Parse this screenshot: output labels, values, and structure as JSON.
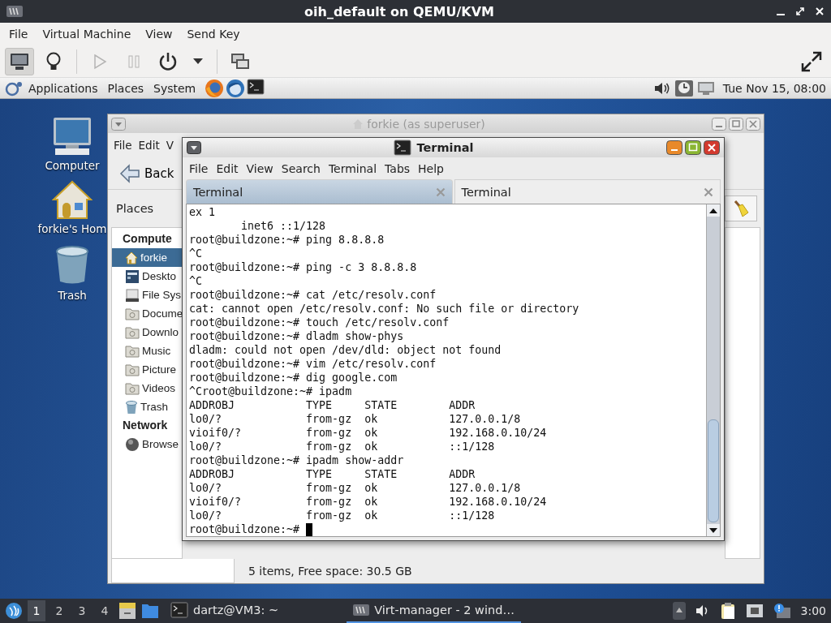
{
  "window": {
    "title": "oih_default on QEMU/KVM"
  },
  "menu": [
    "File",
    "Virtual Machine",
    "View",
    "Send Key"
  ],
  "toolbar": {
    "groups": [
      [
        {
          "kind": "console",
          "selected": true,
          "disabled": false
        },
        {
          "kind": "details",
          "selected": false,
          "disabled": false
        }
      ],
      [
        {
          "kind": "run",
          "selected": false,
          "disabled": true
        },
        {
          "kind": "pause",
          "selected": false,
          "disabled": true
        },
        {
          "kind": "power",
          "selected": false,
          "disabled": false
        },
        {
          "kind": "menu",
          "selected": false,
          "disabled": false
        }
      ],
      [
        {
          "kind": "screenshot",
          "selected": false,
          "disabled": false
        }
      ]
    ],
    "right": [
      {
        "kind": "fullscreen",
        "selected": false,
        "disabled": false
      }
    ]
  },
  "guest_panel": {
    "menus": [
      "Applications",
      "Places",
      "System"
    ],
    "launchers": [
      {
        "kind": "browser"
      },
      {
        "kind": "mail"
      },
      {
        "kind": "terminal"
      }
    ],
    "tray": [
      {
        "kind": "volume"
      },
      {
        "kind": "clock"
      },
      {
        "kind": "display"
      }
    ],
    "clock": "Tue Nov 15, 08:00"
  },
  "desktop_icons": [
    {
      "label": "Computer",
      "kind": "computer"
    },
    {
      "label": "forkie's Hom",
      "kind": "home"
    },
    {
      "label": "Trash",
      "kind": "trash"
    }
  ],
  "file_manager": {
    "title": "forkie (as superuser)",
    "active": false,
    "menu": [
      "File",
      "Edit",
      "V"
    ],
    "back": "Back",
    "location_label": "Places",
    "sidebar": [
      {
        "title": "Compute",
        "items": [
          {
            "label": "forkie",
            "kind": "home",
            "selected": true
          },
          {
            "label": "Deskto",
            "kind": "desktop",
            "selected": false
          },
          {
            "label": "File Sys",
            "kind": "drive",
            "selected": false
          },
          {
            "label": "Docume",
            "kind": "folder",
            "selected": false
          },
          {
            "label": "Downlo",
            "kind": "folder",
            "selected": false
          },
          {
            "label": "Music",
            "kind": "folder",
            "selected": false
          },
          {
            "label": "Picture",
            "kind": "folder",
            "selected": false
          },
          {
            "label": "Videos",
            "kind": "folder",
            "selected": false
          },
          {
            "label": "Trash",
            "kind": "trash",
            "selected": false
          }
        ]
      },
      {
        "title": "Network",
        "items": [
          {
            "label": "Browse",
            "kind": "network",
            "selected": false
          }
        ]
      }
    ],
    "status": "5 items, Free space: 30.5 GB"
  },
  "terminal": {
    "title": "Terminal",
    "active": true,
    "menu": [
      "File",
      "Edit",
      "View",
      "Search",
      "Terminal",
      "Tabs",
      "Help"
    ],
    "tabs": [
      {
        "label": "Terminal",
        "selected": true
      },
      {
        "label": "Terminal",
        "selected": false
      }
    ],
    "lines": [
      "ex 1",
      "        inet6 ::1/128",
      "root@buildzone:~# ping 8.8.8.8",
      "^C",
      "root@buildzone:~# ping -c 3 8.8.8.8",
      "^C",
      "root@buildzone:~# cat /etc/resolv.conf",
      "cat: cannot open /etc/resolv.conf: No such file or directory",
      "root@buildzone:~# touch /etc/resolv.conf",
      "root@buildzone:~# dladm show-phys",
      "dladm: could not open /dev/dld: object not found",
      "root@buildzone:~# vim /etc/resolv.conf",
      "root@buildzone:~# dig google.com",
      "^Croot@buildzone:~# ipadm",
      "ADDROBJ           TYPE     STATE        ADDR",
      "lo0/?             from-gz  ok           127.0.0.1/8",
      "vioif0/?          from-gz  ok           192.168.0.10/24",
      "lo0/?             from-gz  ok           ::1/128",
      "root@buildzone:~# ipadm show-addr",
      "ADDROBJ           TYPE     STATE        ADDR",
      "lo0/?             from-gz  ok           127.0.0.1/8",
      "vioif0/?          from-gz  ok           192.168.0.10/24",
      "lo0/?             from-gz  ok           ::1/128"
    ],
    "prompt": "root@buildzone:~#"
  },
  "taskbar": {
    "workspaces": [
      {
        "label": "1",
        "selected": true
      },
      {
        "label": "2",
        "selected": false
      },
      {
        "label": "3",
        "selected": false
      },
      {
        "label": "4",
        "selected": false
      }
    ],
    "launchers": [
      {
        "kind": "files"
      },
      {
        "kind": "folder"
      }
    ],
    "tasks": [
      {
        "label": "dartz@VM3: ~",
        "kind": "terminal",
        "selected": false
      },
      {
        "label": "Virt-manager - 2 wind…",
        "kind": "vm",
        "selected": true
      }
    ],
    "tray": [
      {
        "kind": "eject"
      },
      {
        "kind": "volume"
      },
      {
        "kind": "clipboard"
      },
      {
        "kind": "network"
      },
      {
        "kind": "notification"
      }
    ],
    "clock": "3:00"
  }
}
